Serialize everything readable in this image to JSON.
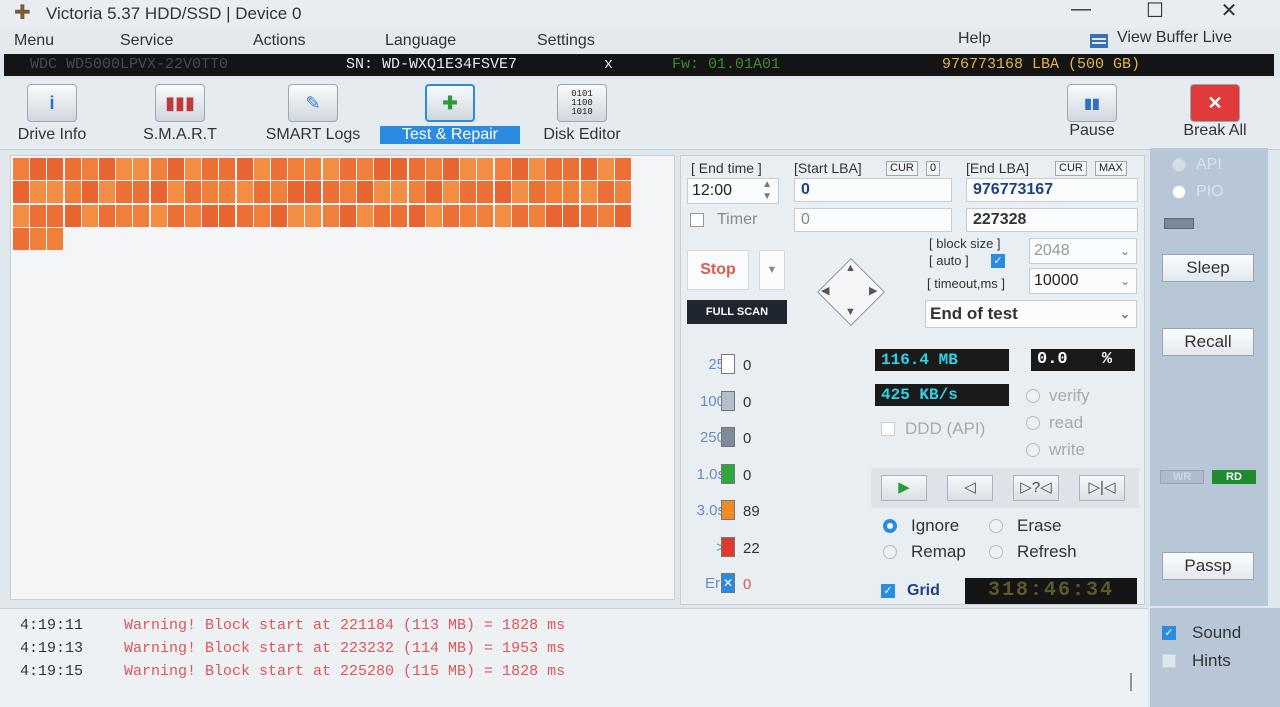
{
  "window": {
    "title": "Victoria 5.37 HDD/SSD | Device 0",
    "minimize": "—",
    "maximize": "☐",
    "close": "✕"
  },
  "menu": {
    "items": [
      "Menu",
      "Service",
      "Actions",
      "Language",
      "Settings"
    ],
    "help": "Help",
    "view_buffer": "View Buffer Live"
  },
  "drive": {
    "model": "WDC WD5000LPVX-22V0TT0",
    "serial": "SN: WD-WXQ1E34FSVE7",
    "close": "x",
    "firmware": "Fw: 01.01A01",
    "capacity": "976773168 LBA (500 GB)"
  },
  "toolbar": {
    "drive_info": "Drive Info",
    "smart": "S.M.A.R.T",
    "smart_logs": "SMART Logs",
    "test_repair": "Test & Repair",
    "disk_editor": "Disk Editor",
    "pause": "Pause",
    "break_all": "Break All"
  },
  "scan": {
    "end_time_label": "[ End time ]",
    "end_time": "12:00",
    "timer_label": "Timer",
    "start_lba_label": "[Start LBA]",
    "cur_label": "CUR",
    "start_cur_value": "0",
    "start_lba": "0",
    "start_lba2": "0",
    "end_lba_label": "[End LBA]",
    "max_label": "MAX",
    "end_lba": "976773167",
    "current_lba": "227328",
    "block_size_label": "[ block size ]",
    "auto_label": "[ auto ]",
    "block_size": "2048",
    "timeout_label": "[ timeout,ms ]",
    "timeout": "10000",
    "end_action": "End of test",
    "stop_label": "Stop",
    "full_scan_label": "FULL SCAN"
  },
  "stats": {
    "size_read": "116.4 MB",
    "percent": "0.0",
    "percent_sign": "%",
    "speed": "425 KB/s",
    "verify": "verify",
    "read": "read",
    "write": "write",
    "ddd": "DDD (API)",
    "histogram": [
      {
        "label": "25",
        "count": "0",
        "color": "#ffffff"
      },
      {
        "label": "100",
        "count": "0",
        "color": "#b5bfcc"
      },
      {
        "label": "250",
        "count": "0",
        "color": "#7d8a9c"
      },
      {
        "label": "1.0s",
        "count": "0",
        "color": "#2ea83a"
      },
      {
        "label": "3.0s",
        "count": "89",
        "color": "#f08a24"
      },
      {
        "label": ">",
        "count": "22",
        "color": "#e03a2a"
      },
      {
        "label": "Err",
        "count": "0",
        "color": "#2b8be0"
      }
    ]
  },
  "controls": {
    "play": "▶",
    "rewind": "◁",
    "random": "▷?◁",
    "end": "▷|◁"
  },
  "actions": {
    "ignore": "Ignore",
    "erase": "Erase",
    "remap": "Remap",
    "refresh": "Refresh"
  },
  "grid": {
    "grid_label": "Grid",
    "clock": "318:46:34"
  },
  "right": {
    "api": "API",
    "pio": "PIO",
    "sleep": "Sleep",
    "recall": "Recall",
    "wr": "WR",
    "rd": "RD",
    "passp": "Passp",
    "sound": "Sound",
    "hints": "Hints"
  },
  "log": [
    {
      "time": "4:19:11",
      "msg": "Warning! Block start at 221184 (113 MB)  = 1828 ms"
    },
    {
      "time": "4:19:13",
      "msg": "Warning! Block start at 223232 (114 MB)  = 1953 ms"
    },
    {
      "time": "4:19:15",
      "msg": "Warning! Block start at 225280 (115 MB)  = 1828 ms"
    }
  ]
}
